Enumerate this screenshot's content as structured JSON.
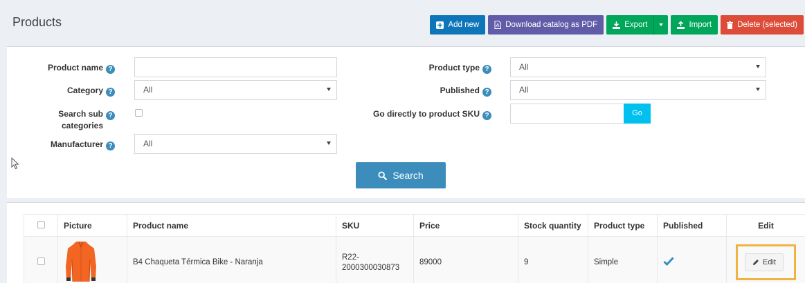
{
  "header": {
    "title": "Products",
    "buttons": {
      "add_new": "Add new",
      "download_pdf": "Download catalog as PDF",
      "export": "Export",
      "import": "Import",
      "delete_selected": "Delete (selected)"
    }
  },
  "search": {
    "product_name": {
      "label": "Product name",
      "value": ""
    },
    "category": {
      "label": "Category",
      "value": "All"
    },
    "search_sub": {
      "label_line1": "Search sub",
      "label_line2": "categories",
      "checked": false
    },
    "manufacturer": {
      "label": "Manufacturer",
      "value": "All"
    },
    "product_type": {
      "label": "Product type",
      "value": "All"
    },
    "published": {
      "label": "Published",
      "value": "All"
    },
    "go_sku": {
      "label": "Go directly to product SKU",
      "value": "",
      "button": "Go"
    },
    "search_button": "Search"
  },
  "table": {
    "headers": {
      "picture": "Picture",
      "name": "Product name",
      "sku": "SKU",
      "price": "Price",
      "stock": "Stock quantity",
      "type": "Product type",
      "published": "Published",
      "edit": "Edit"
    },
    "rows": [
      {
        "name": "B4 Chaqueta Térmica Bike - Naranja",
        "sku_line1": "R22-",
        "sku_line2": "2000300030873",
        "price": "89000",
        "stock": "9",
        "type": "Simple",
        "published": true,
        "edit_label": "Edit"
      }
    ]
  },
  "colors": {
    "primary": "#3c8dbc",
    "add": "#0e76b8",
    "purple": "#605ca8",
    "green": "#00a65a",
    "red": "#dd4b39",
    "info": "#00c0ef",
    "highlight": "#f0b342",
    "jacket": "#f26522"
  }
}
